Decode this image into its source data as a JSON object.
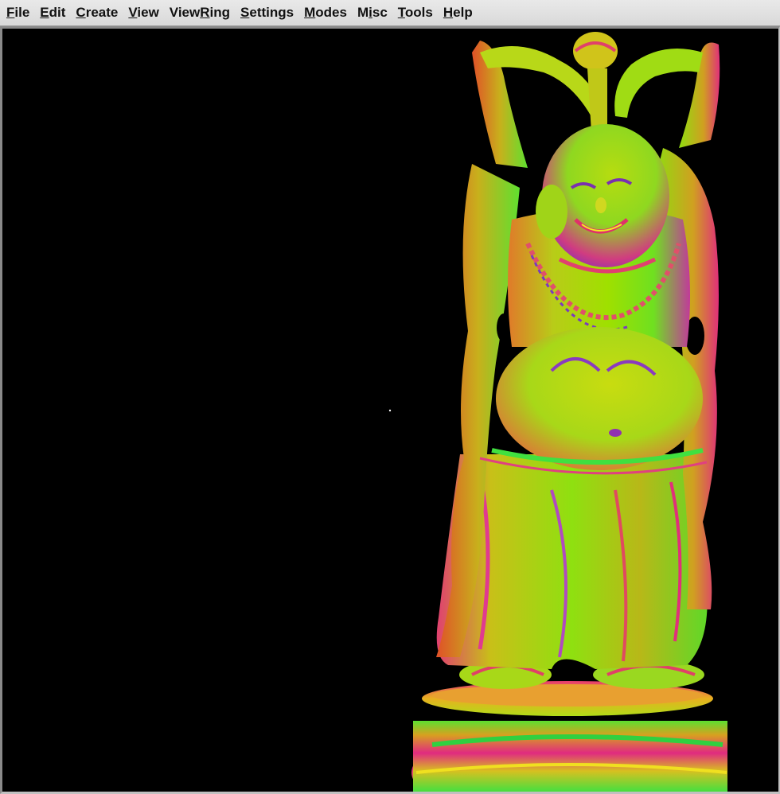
{
  "menubar": {
    "items": [
      {
        "pre": "",
        "ul": "F",
        "post": "ile"
      },
      {
        "pre": "",
        "ul": "E",
        "post": "dit"
      },
      {
        "pre": "",
        "ul": "C",
        "post": "reate"
      },
      {
        "pre": "",
        "ul": "V",
        "post": "iew"
      },
      {
        "pre": "View",
        "ul": "R",
        "post": "ing"
      },
      {
        "pre": "",
        "ul": "S",
        "post": "ettings"
      },
      {
        "pre": "",
        "ul": "M",
        "post": "odes"
      },
      {
        "pre": "M",
        "ul": "i",
        "post": "sc"
      },
      {
        "pre": "",
        "ul": "T",
        "post": "ools"
      },
      {
        "pre": "",
        "ul": "H",
        "post": "elp"
      }
    ]
  },
  "viewport": {
    "background": "#000000",
    "model": "buddha-statue-normal-shaded",
    "colors": {
      "primary": "#9fe000",
      "warm": "#e8742a",
      "magenta": "#e0208a",
      "green": "#2fe040",
      "purple": "#8a3fd0",
      "yellow": "#d8d020"
    }
  }
}
